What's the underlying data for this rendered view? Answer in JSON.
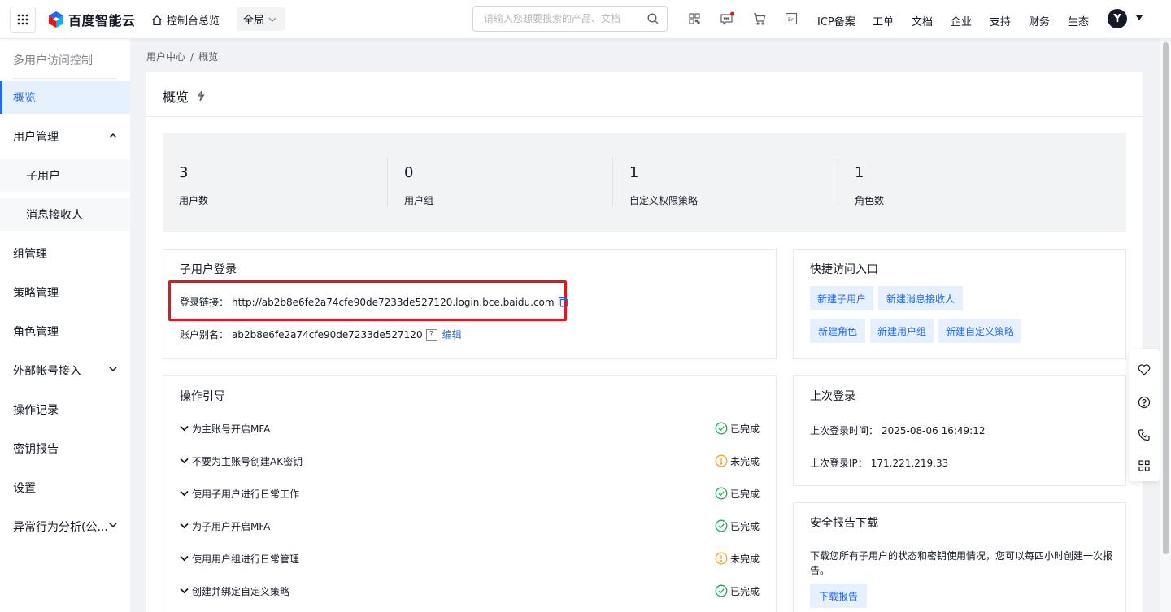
{
  "topbar": {
    "logo_text": "百度智能云",
    "home_label": "控制台总览",
    "region_label": "全局",
    "search_placeholder": "请输入您想要搜索的产品、文档",
    "nav": [
      "ICP备案",
      "工单",
      "文档",
      "企业",
      "支持",
      "财务",
      "生态"
    ],
    "lang_icon_text": "En",
    "avatar_letter": "Y"
  },
  "sidebar": {
    "title": "多用户访问控制",
    "items": [
      {
        "label": "概览"
      },
      {
        "label": "用户管理"
      },
      {
        "label": "子用户"
      },
      {
        "label": "消息接收人"
      },
      {
        "label": "组管理"
      },
      {
        "label": "策略管理"
      },
      {
        "label": "角色管理"
      },
      {
        "label": "外部帐号接入"
      },
      {
        "label": "操作记录"
      },
      {
        "label": "密钥报告"
      },
      {
        "label": "设置"
      },
      {
        "label": "异常行为分析(公..."
      }
    ]
  },
  "breadcrumb": {
    "root": "用户中心",
    "sep": "/",
    "current": "概览"
  },
  "page": {
    "title": "概览"
  },
  "stats": [
    {
      "value": "3",
      "label": "用户数"
    },
    {
      "value": "0",
      "label": "用户组"
    },
    {
      "value": "1",
      "label": "自定义权限策略"
    },
    {
      "value": "1",
      "label": "角色数"
    }
  ],
  "login_card": {
    "title": "子用户登录",
    "link_key": "登录链接：",
    "link_value": "http://ab2b8e6fe2a74cfe90de7233de527120.login.bce.baidu.com",
    "alias_key": "账户别名：",
    "alias_value": "ab2b8e6fe2a74cfe90de7233de527120",
    "help": "?",
    "edit": "编辑"
  },
  "quick_card": {
    "title": "快捷访问入口",
    "buttons": [
      "新建子用户",
      "新建消息接收人",
      "新建角色",
      "新建用户组",
      "新建自定义策略"
    ]
  },
  "guide_card": {
    "title": "操作引导",
    "rows": [
      {
        "label": "为主账号开启MFA",
        "status": "已完成",
        "done": true
      },
      {
        "label": "不要为主账号创建AK密钥",
        "status": "未完成",
        "done": false
      },
      {
        "label": "使用子用户进行日常工作",
        "status": "已完成",
        "done": true
      },
      {
        "label": "为子用户开启MFA",
        "status": "已完成",
        "done": true
      },
      {
        "label": "使用用户组进行日常管理",
        "status": "未完成",
        "done": false
      },
      {
        "label": "创建并绑定自定义策略",
        "status": "已完成",
        "done": true
      }
    ]
  },
  "last_login_card": {
    "title": "上次登录",
    "time_key": "上次登录时间：",
    "time_value": "2025-08-06 16:49:12",
    "ip_key": "上次登录IP：",
    "ip_value": "171.221.219.33"
  },
  "report_card": {
    "title": "安全报告下载",
    "desc": "下载您所有子用户的状态和密钥使用情况，您可以每四小时创建一次报告。",
    "button": "下载报告"
  },
  "colors": {
    "accent": "#2468f2",
    "success": "#1fab5a",
    "warning": "#f5a623",
    "highlight": "#e3171b"
  }
}
